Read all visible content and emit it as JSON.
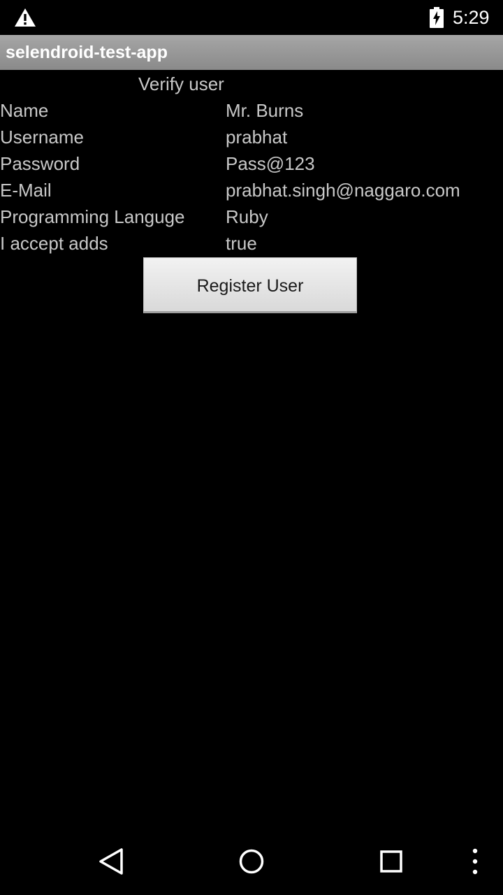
{
  "status_bar": {
    "time": "5:29",
    "icons": [
      "warning-icon",
      "battery-charging-icon"
    ]
  },
  "app": {
    "title": "selendroid-test-app"
  },
  "verify": {
    "heading": "Verify user",
    "rows": [
      {
        "label": "Name",
        "value": "Mr. Burns"
      },
      {
        "label": "Username",
        "value": "prabhat"
      },
      {
        "label": "Password",
        "value": "Pass@123"
      },
      {
        "label": "E-Mail",
        "value": "prabhat.singh@naggaro.com"
      },
      {
        "label": "Programming Languge",
        "value": "Ruby"
      },
      {
        "label": "I accept adds",
        "value": "true"
      }
    ],
    "register_label": "Register User"
  },
  "nav_bar": {
    "icons": [
      "back-icon",
      "home-icon",
      "recents-icon",
      "overflow-menu-icon"
    ]
  },
  "colors": {
    "background": "#000000",
    "title_bar": "#999999",
    "text": "#c8c8c8",
    "button": "#e6e6e6"
  }
}
